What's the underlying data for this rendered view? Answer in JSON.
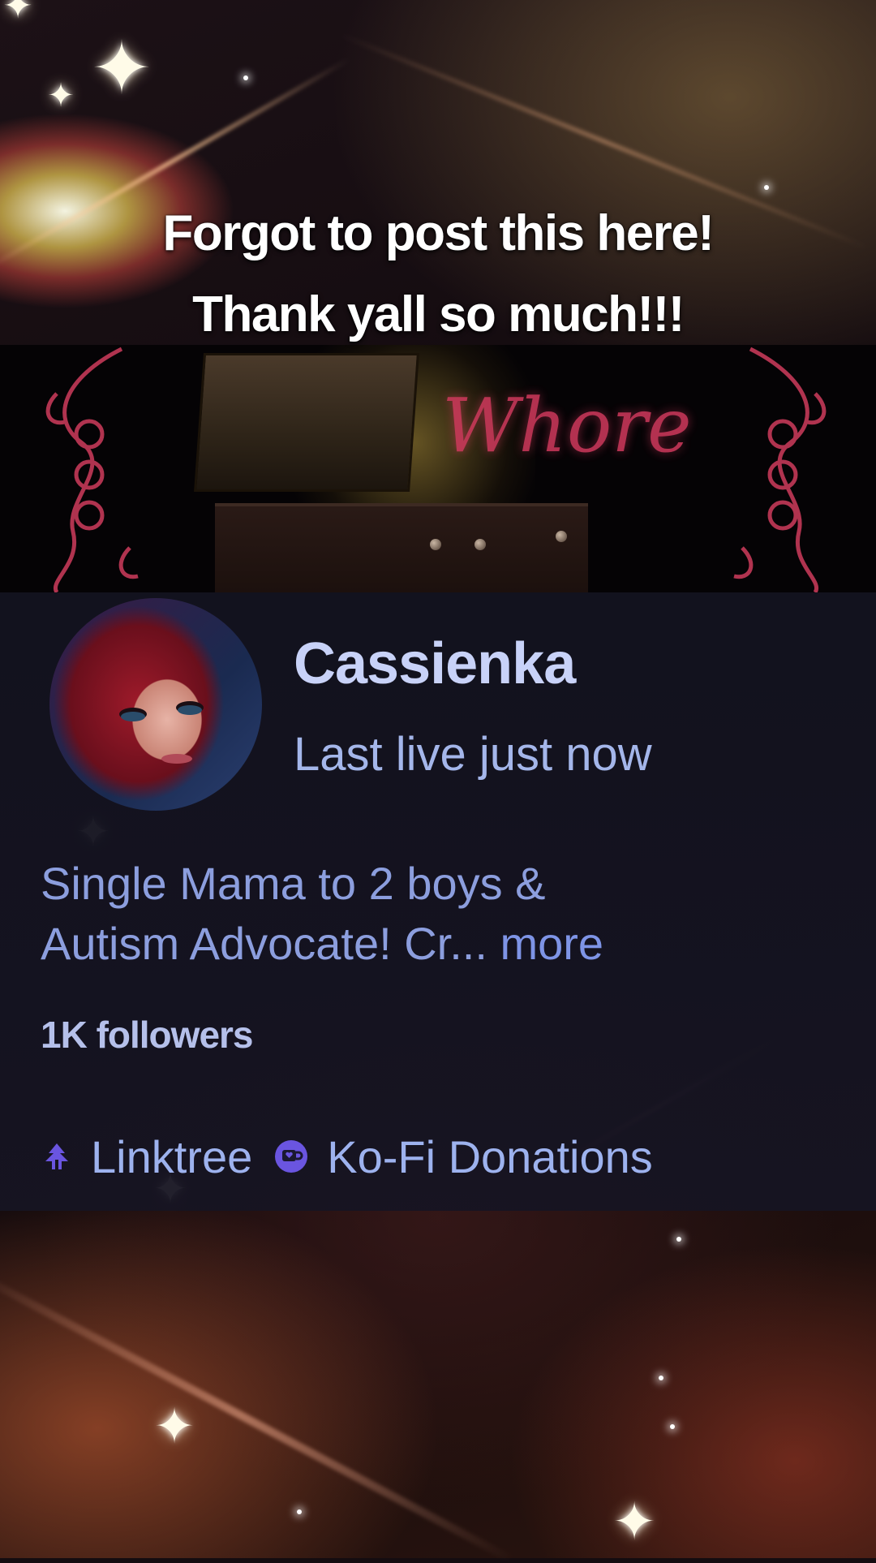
{
  "caption": {
    "line1": "Forgot to post this here!",
    "line2": "Thank yall so much!!!"
  },
  "banner": {
    "script_text": "Whore"
  },
  "profile": {
    "username": "Cassienka",
    "last_live": "Last live just now",
    "bio_line1": "Single Mama to 2 boys &",
    "bio_line2": "Autism Advocate! Cr...",
    "bio_more": "more",
    "followers": "1K followers"
  },
  "links": [
    {
      "label": "Linktree",
      "icon": "linktree-icon"
    },
    {
      "label": "Ko-Fi Donations",
      "icon": "kofi-icon"
    }
  ],
  "colors": {
    "username": "#c8d2f8",
    "link": "#9db2ee",
    "icon_accent": "#6a55e0",
    "banner_script": "#d23a5e"
  }
}
